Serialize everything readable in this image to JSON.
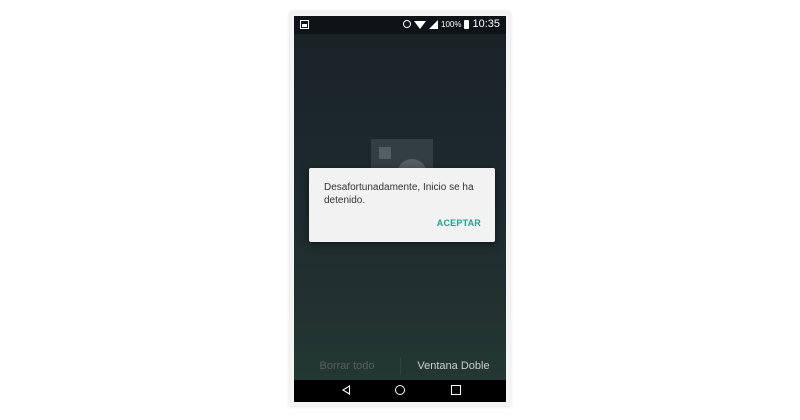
{
  "status_bar": {
    "battery": "100%",
    "time": "10:35",
    "icons": [
      "gallery-icon",
      "alarm-icon",
      "wifi-icon",
      "signal-icon",
      "battery-icon"
    ]
  },
  "dialog": {
    "message": "Desafortunadamente, Inicio se ha detenido.",
    "accept_label": "ACEPTAR"
  },
  "bottom_actions": {
    "clear_all": "Borrar todo",
    "dual_window": "Ventana Doble"
  },
  "nav_icons": [
    "back-icon",
    "home-icon",
    "recent-apps-icon"
  ],
  "colors": {
    "accent": "#1fa38f",
    "dialog_bg": "#f2f2f2",
    "screen_bg": "#1d2a2f"
  }
}
